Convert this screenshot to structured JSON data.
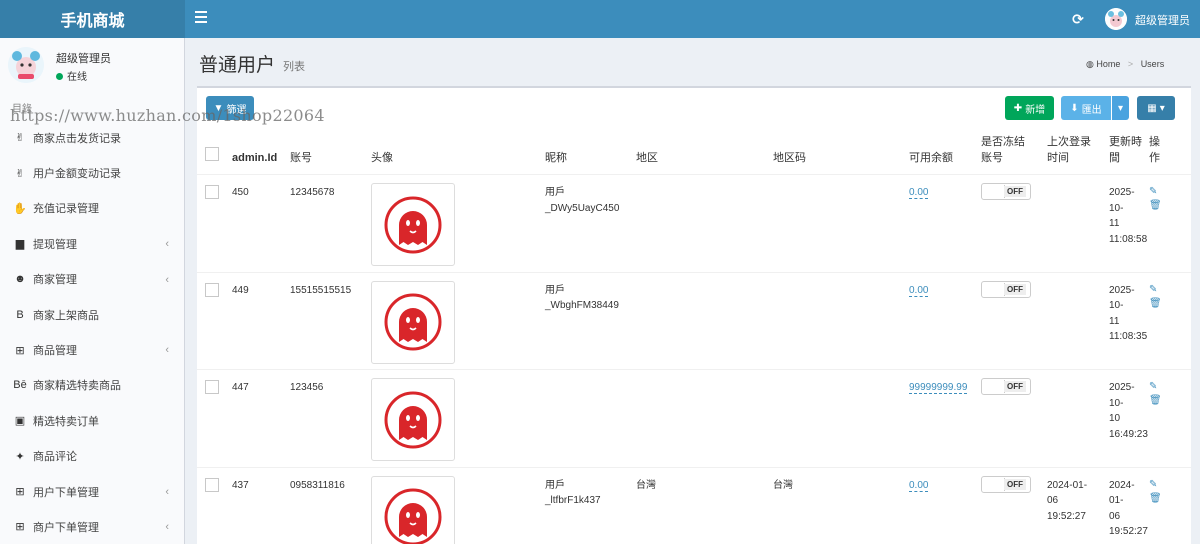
{
  "brand": "手机商城",
  "topbar": {
    "user_name": "超级管理员"
  },
  "user_panel": {
    "name": "超级管理员",
    "status": "在线"
  },
  "watermark": "https://www.huzhan.com/1shop22064",
  "menu_header": "目錄",
  "menu": [
    {
      "label": "商家点击发货记录",
      "icon": "medal-icon",
      "glyph": "✌",
      "submenu": false
    },
    {
      "label": "用户金额变动记录",
      "icon": "medal-icon",
      "glyph": "✌",
      "submenu": false
    },
    {
      "label": "充值记录管理",
      "icon": "handshake-icon",
      "glyph": "✋",
      "submenu": false
    },
    {
      "label": "提现管理",
      "icon": "book-icon",
      "glyph": "▆",
      "submenu": true
    },
    {
      "label": "商家管理",
      "icon": "github-icon",
      "glyph": "☻",
      "submenu": true
    },
    {
      "label": "商家上架商品",
      "icon": "bitcoin-icon",
      "glyph": "B",
      "submenu": false
    },
    {
      "label": "商品管理",
      "icon": "cart-icon",
      "glyph": "⊞",
      "submenu": true
    },
    {
      "label": "商家精选特卖商品",
      "icon": "behance-icon",
      "glyph": "Bē",
      "submenu": false
    },
    {
      "label": "精选特卖订单",
      "icon": "archive-icon",
      "glyph": "▣",
      "submenu": false
    },
    {
      "label": "商品评论",
      "icon": "android-icon",
      "glyph": "✦",
      "submenu": false
    },
    {
      "label": "用户下单管理",
      "icon": "cart-icon",
      "glyph": "⊞",
      "submenu": true
    },
    {
      "label": "商户下单管理",
      "icon": "cart-icon",
      "glyph": "⊞",
      "submenu": true
    }
  ],
  "page": {
    "title": "普通用户",
    "subtitle": "列表"
  },
  "breadcrumb": {
    "home": "Home",
    "current": "Users"
  },
  "toolbar": {
    "filter": "篩選",
    "new": "新增",
    "export": "匯出"
  },
  "table": {
    "headers": {
      "id": "admin.Id",
      "account": "账号",
      "avatar": "头像",
      "nickname": "昵称",
      "region": "地区",
      "region_code": "地区码",
      "balance": "可用余额",
      "frozen_line1": "是否冻结",
      "frozen_line2": "账号",
      "last_login_line1": "上次登录",
      "last_login_line2": "时间",
      "updated": "更新時間",
      "action_line1": "操",
      "action_line2": "作"
    },
    "rows": [
      {
        "id": "450",
        "account": "12345678",
        "nickname_line1": "用戶",
        "nickname_line2": "_DWy5UayC450",
        "region": "",
        "region_code": "",
        "balance": "0.00",
        "frozen": "OFF",
        "last_login_1": "",
        "last_login_2": "",
        "last_login_3": "",
        "updated_1": "2025-10-",
        "updated_2": "11",
        "updated_3": "11:08:58"
      },
      {
        "id": "449",
        "account": "15515515515",
        "nickname_line1": "用戶",
        "nickname_line2": "_WbghFM38449",
        "region": "",
        "region_code": "",
        "balance": "0.00",
        "frozen": "OFF",
        "last_login_1": "",
        "last_login_2": "",
        "last_login_3": "",
        "updated_1": "2025-10-",
        "updated_2": "11",
        "updated_3": "11:08:35"
      },
      {
        "id": "447",
        "account": "123456",
        "nickname_line1": "",
        "nickname_line2": "",
        "region": "",
        "region_code": "",
        "balance": "99999999.99",
        "frozen": "OFF",
        "last_login_1": "",
        "last_login_2": "",
        "last_login_3": "",
        "updated_1": "2025-10-",
        "updated_2": "10",
        "updated_3": "16:49:23"
      },
      {
        "id": "437",
        "account": "0958311816",
        "nickname_line1": "用戶",
        "nickname_line2": "_ltfbrF1k437",
        "region": "台灣",
        "region_code": "台灣",
        "balance": "0.00",
        "frozen": "OFF",
        "last_login_1": "2024-01-",
        "last_login_2": "06",
        "last_login_3": "19:52:27",
        "updated_1": "2024-01-",
        "updated_2": "06",
        "updated_3": "19:52:27"
      }
    ]
  },
  "colors": {
    "header": "#3c8dbc",
    "brand_bg": "#367fa9",
    "success": "#00a65a",
    "avatar_red": "#d9262a"
  }
}
